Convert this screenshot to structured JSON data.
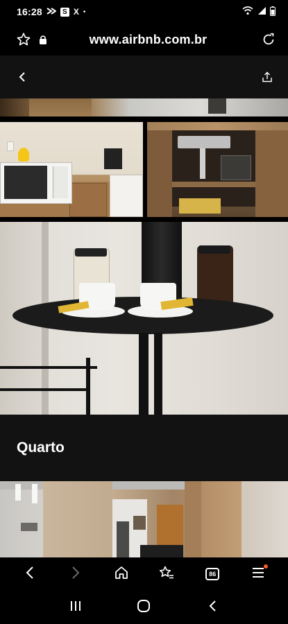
{
  "status_bar": {
    "time": "16:28",
    "notification_icons": [
      "double-arrow-icon",
      "s-app-icon",
      "x-app-icon"
    ],
    "s_app_letter": "S",
    "x_app_letter": "X",
    "dot": "•",
    "right_icons": [
      "wifi-icon",
      "signal-icon",
      "battery-icon"
    ]
  },
  "browser": {
    "url": "www.airbnb.com.br",
    "tabs_count": "86"
  },
  "page": {
    "section_title": "Quarto"
  },
  "colors": {
    "background": "#000000",
    "header_bg": "#121212",
    "notification_dot": "#ff5a2b"
  }
}
